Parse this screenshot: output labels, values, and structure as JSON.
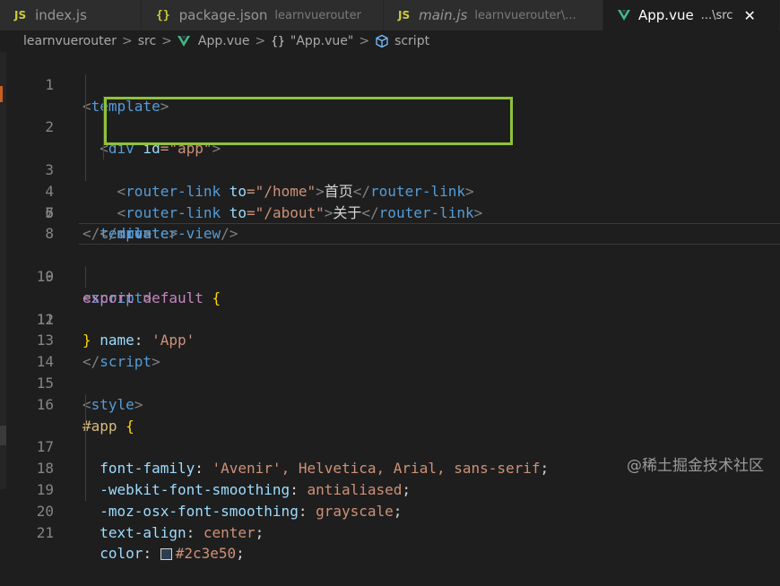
{
  "tabs": [
    {
      "icon": "JS",
      "name": "index.js",
      "desc": ""
    },
    {
      "icon": "{}",
      "name": "package.json",
      "desc": "learnvuerouter"
    },
    {
      "icon": "JS",
      "name": "main.js",
      "desc": "learnvuerouter\\..."
    },
    {
      "icon": "vue-icon",
      "name": "App.vue",
      "desc": "...\\src",
      "close": "✕"
    }
  ],
  "breadcrumb": {
    "root": "learnvuerouter",
    "folder": "src",
    "file": "App.vue",
    "braces": "{}",
    "component": "\"App.vue\"",
    "section": "script",
    "separator": ">"
  },
  "code": {
    "line_numbers": [
      "1",
      "2",
      "3",
      "4",
      "5",
      "6",
      "7",
      "8",
      "9",
      "10",
      "11",
      "12",
      "13",
      "14",
      "15",
      "16",
      "17",
      "18",
      "19",
      "20",
      "21"
    ],
    "l1": [
      "<",
      "template",
      ">"
    ],
    "l2": [
      "<",
      "div",
      "id",
      "=\"app\"",
      ">"
    ],
    "l3": [
      "<",
      "router-link",
      "to",
      "=\"/home\"",
      ">",
      "首页",
      "</",
      "router-link",
      ">"
    ],
    "l4": [
      "<",
      "router-link",
      "to",
      "=\"/about\"",
      ">",
      "关于",
      "</",
      "router-link",
      ">"
    ],
    "l5": [
      "<",
      "router-view",
      "/>"
    ],
    "l6": [
      "</",
      "div",
      ">"
    ],
    "l7": [
      "</",
      "template",
      ">"
    ],
    "l9": [
      "<",
      "script",
      ">"
    ],
    "l10": [
      "export",
      "default",
      "{"
    ],
    "l11": [
      "name",
      ": ",
      "'App'"
    ],
    "l12": [
      "}"
    ],
    "l13": [
      "</",
      "script",
      ">"
    ],
    "l15": [
      "<",
      "style",
      ">"
    ],
    "l16": [
      "#app",
      "{"
    ],
    "l17": [
      "font-family",
      ": ",
      "'Avenir'",
      ", Helvetica, Arial, sans-serif",
      ";"
    ],
    "l18": [
      "-webkit-font-smoothing",
      ": ",
      "antialiased",
      ";"
    ],
    "l19": [
      "-moz-osx-font-smoothing",
      ": ",
      "grayscale",
      ";"
    ],
    "l20": [
      "text-align",
      ": ",
      "center",
      ";"
    ],
    "l21": [
      "color",
      ": ",
      "#2c3e50",
      ";"
    ]
  },
  "watermark": "@稀土掘金技术社区",
  "colors": {
    "highlight_box": "#8fc23a",
    "tag": "#569cd6",
    "string": "#ce9178",
    "keyword": "#c586c0"
  }
}
